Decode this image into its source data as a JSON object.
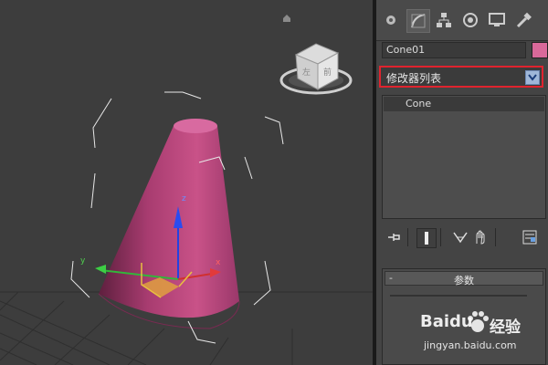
{
  "command_panel": {
    "tabs": [
      {
        "icon": "create-icon"
      },
      {
        "icon": "modify-icon"
      },
      {
        "icon": "hierarchy-icon"
      },
      {
        "icon": "motion-icon"
      },
      {
        "icon": "display-icon"
      },
      {
        "icon": "utilities-icon"
      }
    ],
    "object_name": "Cone01",
    "object_color": "#d9699a",
    "modifier_list_label": "修改器列表",
    "highlight_color": "#e0232e",
    "stack_items": [
      "Cone"
    ],
    "stack_buttons": [
      {
        "icon": "pin-stack-icon"
      },
      {
        "icon": "show-end-result-icon"
      },
      {
        "icon": "make-unique-icon"
      },
      {
        "icon": "remove-modifier-icon"
      },
      {
        "icon": "configure-modifier-sets-icon"
      }
    ],
    "rollout_title": "参数",
    "rollout_toggle": "-"
  },
  "viewport": {
    "object_type": "cone",
    "cone_color": "#c04a82",
    "gizmo_axes": [
      "x",
      "y",
      "z"
    ],
    "viewcube_faces": [
      "左",
      "前"
    ]
  },
  "watermark": {
    "brand": "Baidu",
    "product": "经验",
    "url": "jingyan.baidu.com"
  }
}
